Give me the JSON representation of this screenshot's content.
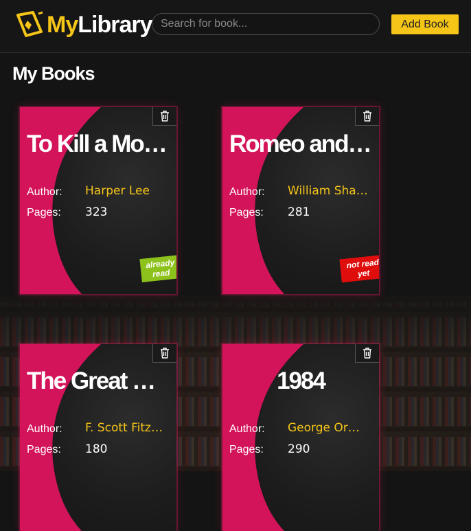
{
  "app": {
    "logo_my": "My",
    "logo_library": "Library",
    "search_placeholder": "Search for book...",
    "add_button_label": "Add Book"
  },
  "colors": {
    "accent_yellow": "#f5c518",
    "accent_pink": "#d4145a",
    "badge_read": "#8dc11b",
    "badge_unread": "#e00d0d"
  },
  "section_title": "My Books",
  "labels": {
    "author": "Author:",
    "pages": "Pages:"
  },
  "books": [
    {
      "title": "To Kill a Mocki...",
      "author": "Harper Lee",
      "pages": "323",
      "status": "already read",
      "status_line1": "already",
      "status_line2": "read"
    },
    {
      "title": "Romeo and Ju...",
      "author": "William Shak...",
      "pages": "281",
      "status": "not read yet",
      "status_line1": "not read",
      "status_line2": "yet"
    },
    {
      "title": "The Great Gat...",
      "author": "F. Scott Fitzg...",
      "pages": "180"
    },
    {
      "title": "1984",
      "author": "George Orwell",
      "pages": "290"
    }
  ],
  "icons": {
    "logo": "book-logo-icon",
    "delete": "trash-icon"
  }
}
